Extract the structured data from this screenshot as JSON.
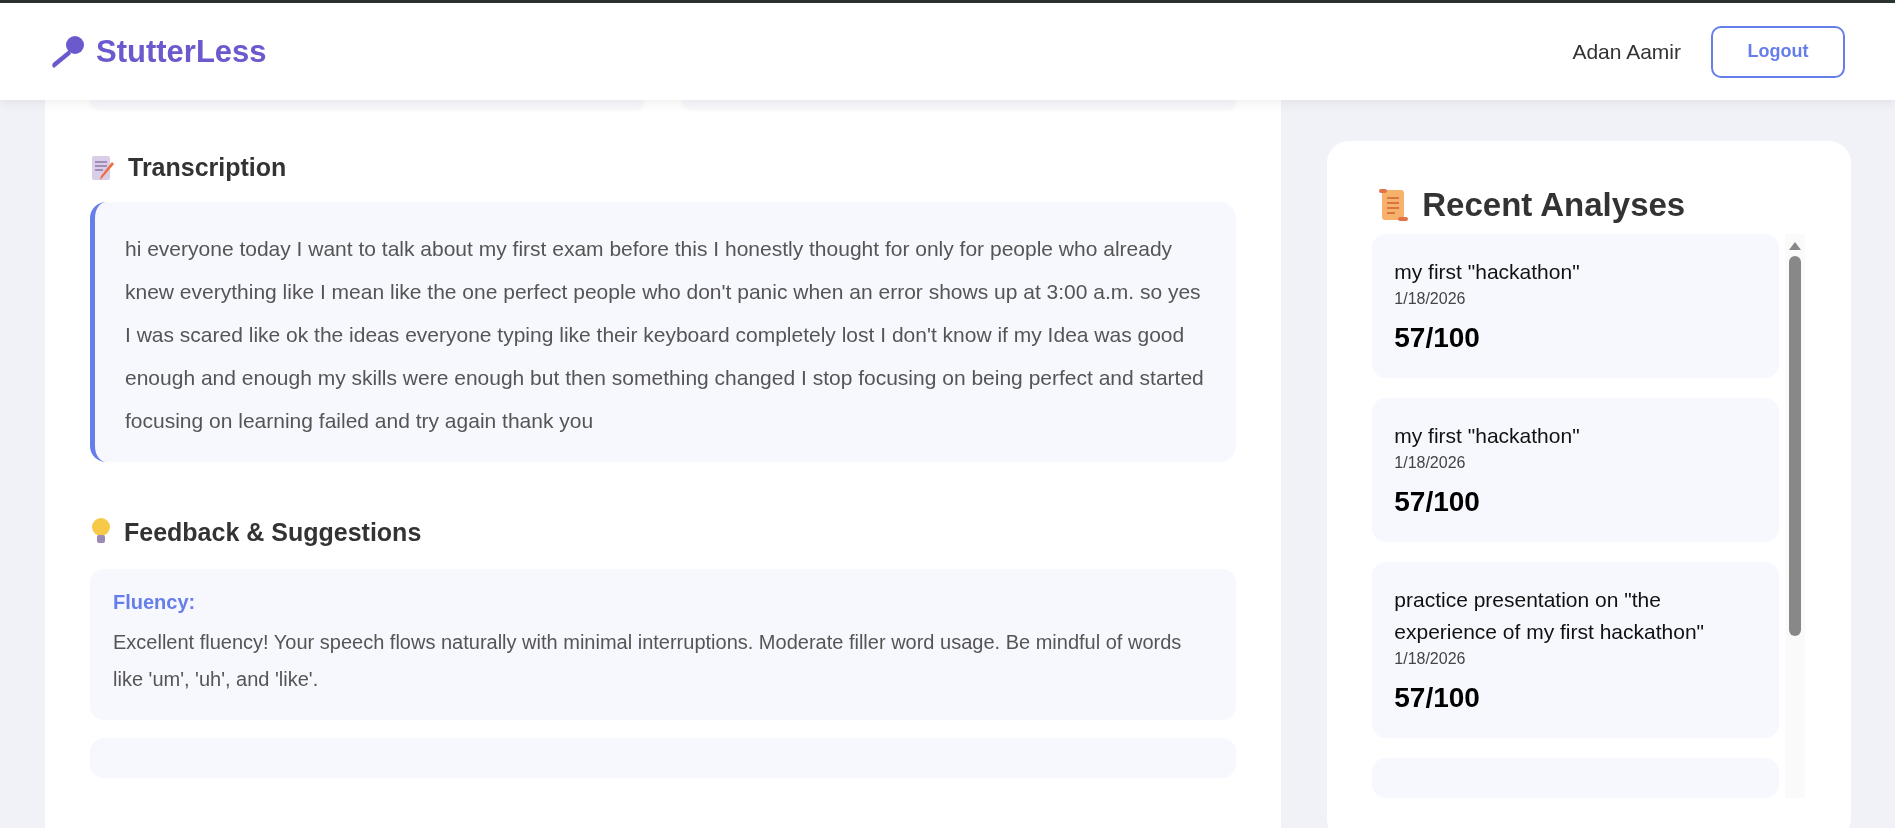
{
  "header": {
    "brand": "StutterLess",
    "user": "Adan Aamir",
    "logout": "Logout"
  },
  "transcription": {
    "title": "Transcription",
    "text": "hi everyone today I want to talk about my first exam before this I honestly thought for only for people who already knew everything like I mean like the one perfect people who don't panic when an error shows up at 3:00 a.m. so yes I was scared like ok the ideas everyone typing like their keyboard completely lost I don't know if my Idea was good enough and enough my skills were enough but then something changed I stop focusing on being perfect and started focusing on learning failed and try again thank you"
  },
  "feedback": {
    "title": "Feedback & Suggestions",
    "items": [
      {
        "label": "Fluency:",
        "text": "Excellent fluency! Your speech flows naturally with minimal interruptions. Moderate filler word usage. Be mindful of words like 'um', 'uh', and 'like'."
      }
    ]
  },
  "recent": {
    "title": "Recent Analyses",
    "items": [
      {
        "title": "my first \"hackathon\"",
        "date": "1/18/2026",
        "score": "57/100"
      },
      {
        "title": "my first \"hackathon\"",
        "date": "1/18/2026",
        "score": "57/100"
      },
      {
        "title": "practice presentation on \"the experience of my first hackathon\"",
        "date": "1/18/2026",
        "score": "57/100"
      }
    ]
  }
}
